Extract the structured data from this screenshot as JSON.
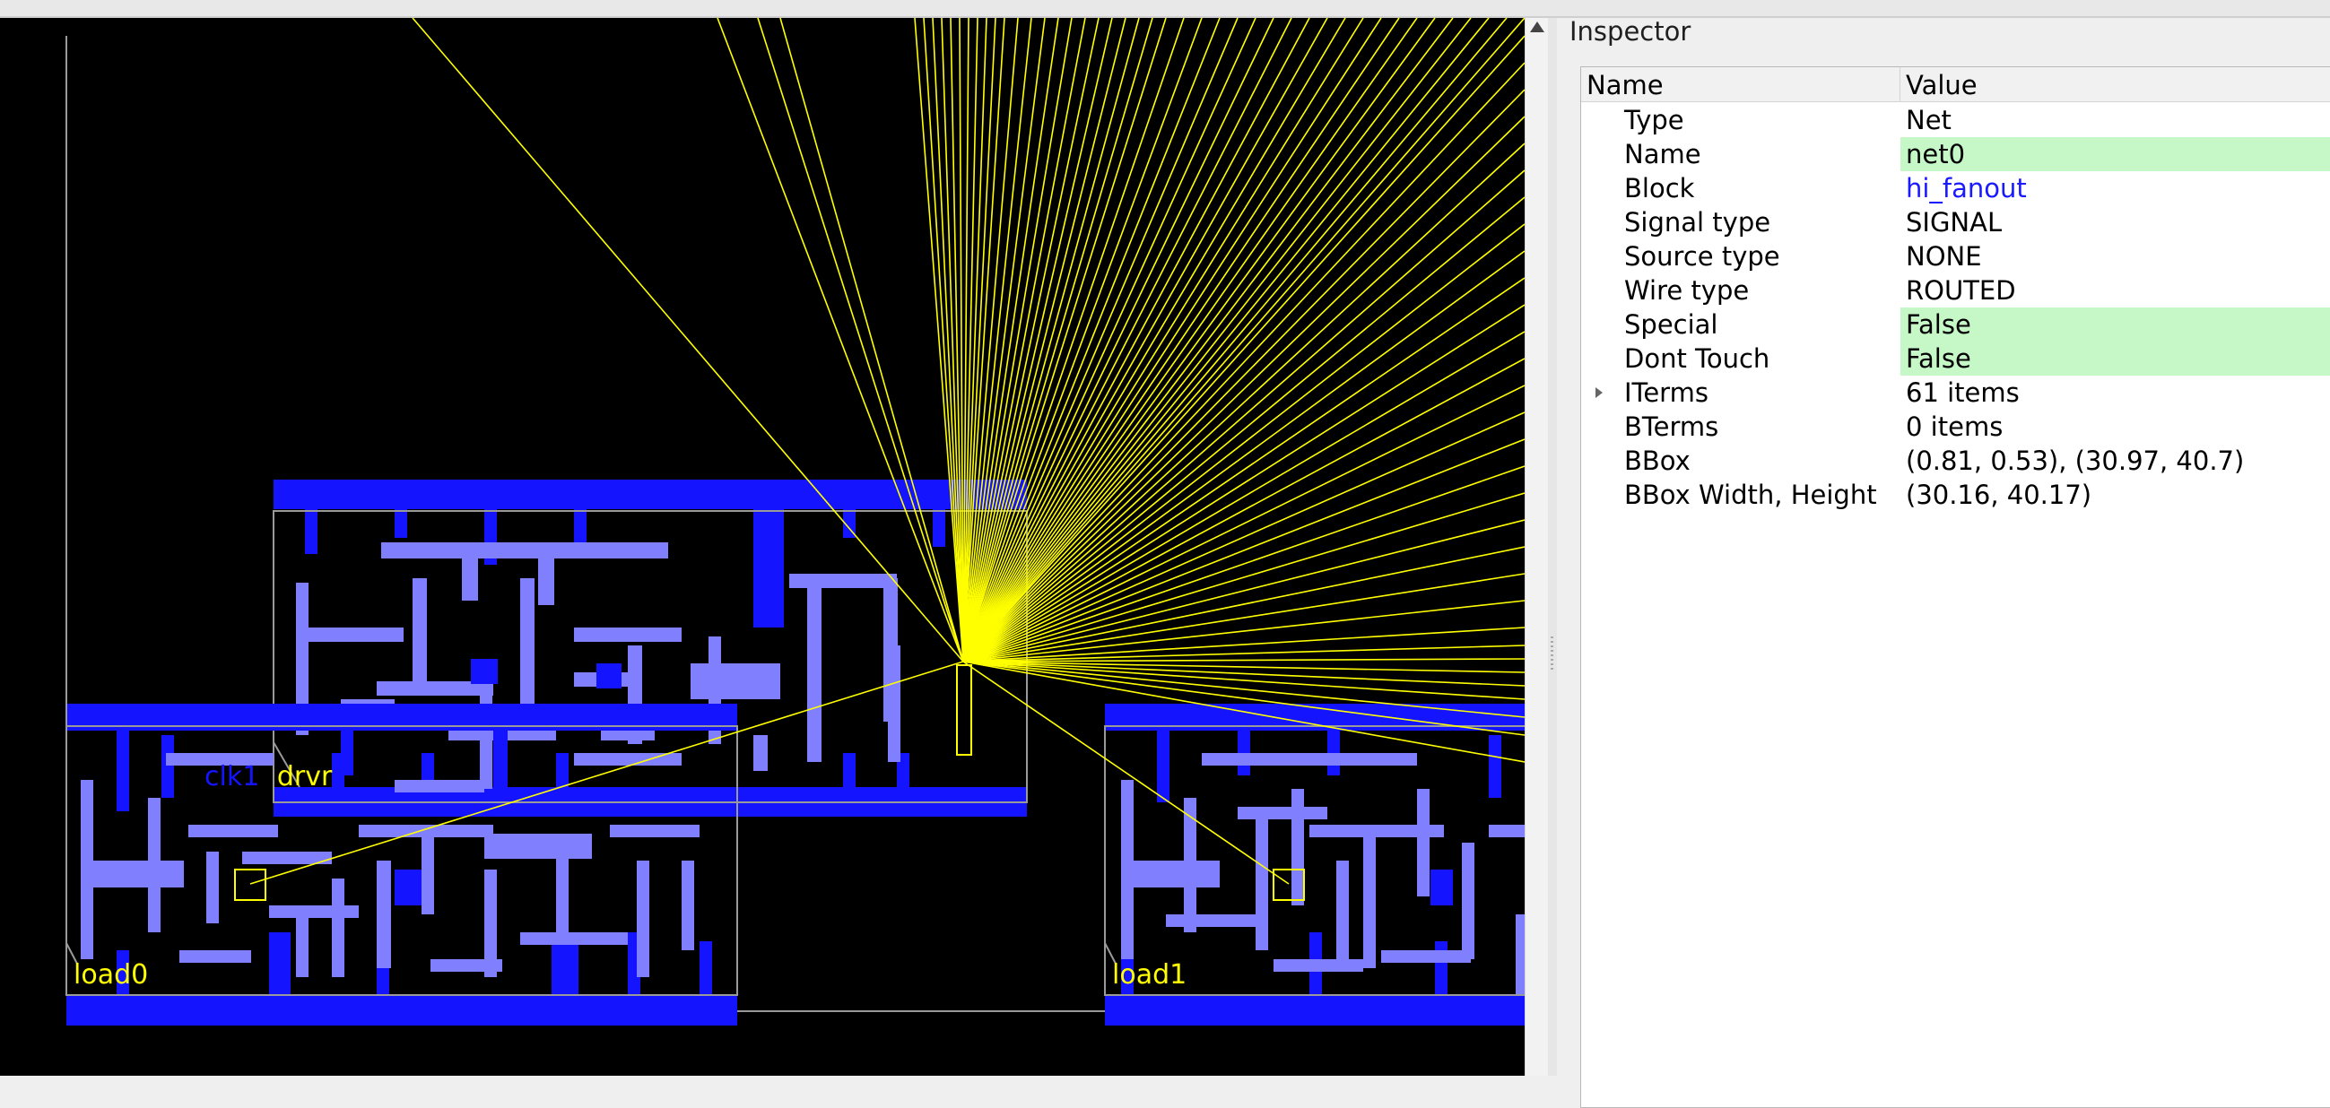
{
  "colors": {
    "canvas_bg": "#000000",
    "flyline": "#ffff00",
    "rail": "#1414ff",
    "pin": "#8080ff",
    "cell_outline": "#9a9a9a",
    "value_highlight": "#c6f7c6",
    "link": "#1a1aff"
  },
  "layout": {
    "labels": {
      "drv_prefix": "clk1",
      "drv_suffix": "drvr",
      "load0": "load0",
      "load1": "load1"
    }
  },
  "inspector": {
    "title": "Inspector",
    "columns": {
      "name": "Name",
      "value": "Value"
    },
    "rows": [
      {
        "name": "Type",
        "value": "Net",
        "style": "plain"
      },
      {
        "name": "Name",
        "value": "net0",
        "style": "green"
      },
      {
        "name": "Block",
        "value": "hi_fanout",
        "style": "link"
      },
      {
        "name": "Signal type",
        "value": "SIGNAL",
        "style": "plain"
      },
      {
        "name": "Source type",
        "value": "NONE",
        "style": "plain"
      },
      {
        "name": "Wire type",
        "value": "ROUTED",
        "style": "plain"
      },
      {
        "name": "Special",
        "value": "False",
        "style": "green"
      },
      {
        "name": "Dont Touch",
        "value": "False",
        "style": "green"
      },
      {
        "name": "ITerms",
        "value": "61 items",
        "style": "plain",
        "expandable": true
      },
      {
        "name": "BTerms",
        "value": "0 items",
        "style": "plain"
      },
      {
        "name": "BBox",
        "value": "(0.81, 0.53), (30.97, 40.7)",
        "style": "plain"
      },
      {
        "name": "BBox Width, Height",
        "value": "(30.16, 40.17)",
        "style": "plain"
      }
    ]
  }
}
